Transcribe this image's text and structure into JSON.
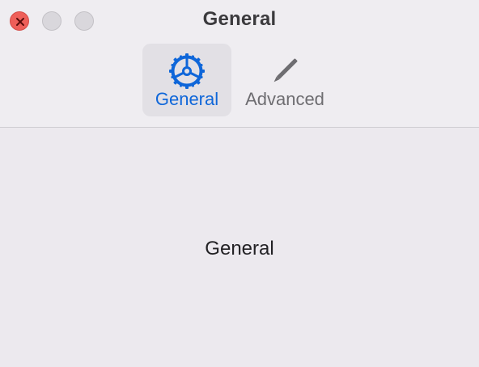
{
  "window": {
    "title": "General"
  },
  "toolbar": {
    "items": [
      {
        "label": "General",
        "icon": "gear-icon",
        "selected": true
      },
      {
        "label": "Advanced",
        "icon": "pencil-icon",
        "selected": false
      }
    ]
  },
  "content": {
    "label": "General"
  },
  "colors": {
    "accent": "#0e66d9",
    "close_button": "#ee5f59",
    "inactive_button": "#d9d7dc"
  }
}
